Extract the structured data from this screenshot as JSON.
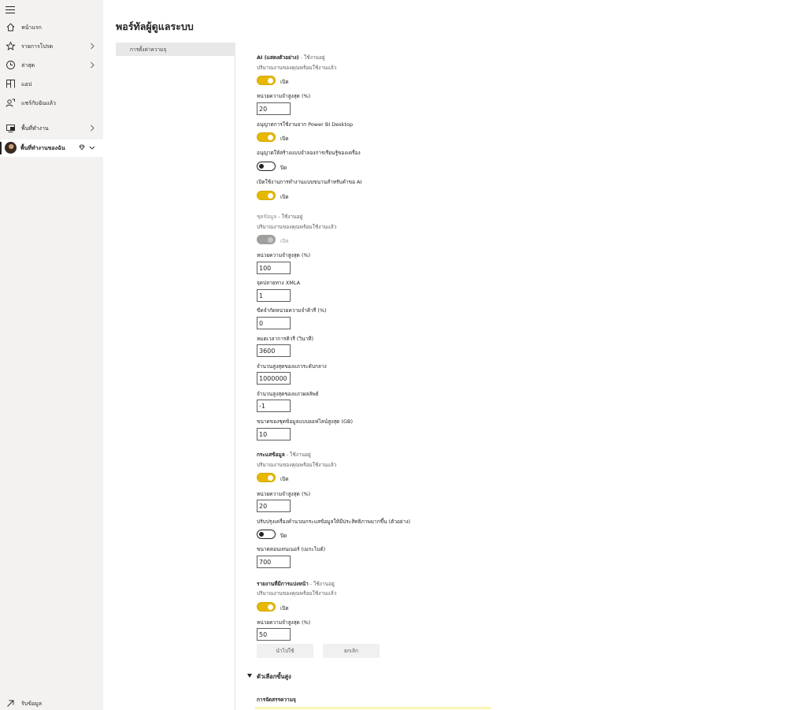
{
  "nav": {
    "items": [
      {
        "label": "หน้าแรก",
        "icon": "home-icon"
      },
      {
        "label": "รายการโปรด",
        "icon": "star-icon"
      },
      {
        "label": "ล่าสุด",
        "icon": "clock-icon"
      },
      {
        "label": "แอป",
        "icon": "apps-icon"
      },
      {
        "label": "แชร์กับฉันแล้ว",
        "icon": "shared-icon"
      },
      {
        "label": "พื้นที่ทำงาน",
        "icon": "workspaces-icon"
      },
      {
        "label": "พื้นที่ทำงานของฉัน",
        "icon": "avatar"
      }
    ],
    "bottom": {
      "label": "รับข้อมูล",
      "icon": "get-data-arrow-icon"
    }
  },
  "header": {
    "title": "พอร์ทัลผู้ดูแลระบบ"
  },
  "tabs": [
    {
      "label": "การตั้งค่าความจุ"
    }
  ],
  "settings": {
    "ai": {
      "title": "AI (แสดงตัวอย่าง)",
      "status": " - ใช้งานอยู่",
      "subtext": "ปริมาณงานของคุณพร้อมใช้งานแล้ว",
      "toggle_label": "เปิด",
      "max_memory_label": "หน่วยความจำสูงสุด (%)",
      "max_memory_value": "20",
      "allow_desktop_label": "อนุญาตการใช้งานจาก Power BI Desktop",
      "allow_desktop_toggle": "เปิด",
      "allow_local_label": "อนุญาตให้สร้างแบบจำลองการเรียนรู้ของเครื่อง",
      "allow_local_toggle": "ปิด",
      "parallel_label": "เปิดใช้งานการทำงานแบบขนานสำหรับคำขอ AI",
      "parallel_toggle": "เปิด"
    },
    "datasets": {
      "title": "ชุดข้อมูล",
      "status": " - ใช้งานอยู่",
      "subtext": "ปริมาณงานของคุณพร้อมใช้งานแล้ว",
      "toggle_label": "เปิด",
      "max_memory_label": "หน่วยความจำสูงสุด (%)",
      "max_memory_value": "100",
      "xmla_label": "จุดปลายทาง XMLA",
      "xmla_value": "1",
      "query_memory_label": "ขีดจำกัดหน่วยความจำคิวรี (%)",
      "query_memory_value": "0",
      "query_timeout_label": "หมดเวลาการคิวรี (วินาที)",
      "query_timeout_value": "3600",
      "max_intermediate_label": "จำนวนสูงสุดของแถวระดับกลาง",
      "max_intermediate_value": "1000000",
      "max_result_label": "จำนวนสูงสุดของแถวผลลัพธ์",
      "max_result_value": "-1",
      "max_offline_label": "ขนาดของชุดข้อมูลแบบออฟไลน์สูงสุด (GB)",
      "max_offline_value": "10"
    },
    "dataflows": {
      "title": "กระแสข้อมูล",
      "status": " - ใช้งานอยู่",
      "subtext": "ปริมาณงานของคุณพร้อมใช้งานแล้ว",
      "toggle_label": "เปิด",
      "max_memory_label": "หน่วยความจำสูงสุด (%)",
      "max_memory_value": "20",
      "enhanced_label": "ปรับปรุงเครื่องคำนวณกระแสข้อมูลให้มีประสิทธิภาพมากขึ้น (ตัวอย่าง)",
      "enhanced_toggle": "ปิด",
      "container_label": "ขนาดคอนเทนเนอร์ (เมกะไบต์)",
      "container_value": "700"
    },
    "paginated": {
      "title": "รายงานที่มีการแบ่งหน้า",
      "status": " - ใช้งานอยู่",
      "subtext": "ปริมาณงานของคุณพร้อมใช้งานแล้ว",
      "toggle_label": "เปิด",
      "max_memory_label": "หน่วยความจำสูงสุด (%)",
      "max_memory_value": "50"
    },
    "buttons": {
      "apply": "นำไปใช้",
      "cancel": "ยกเลิก"
    },
    "advanced": {
      "title": "ตัวเลือกขั้นสูง",
      "memory_title": "การจัดสรรความจุ"
    }
  },
  "colors": {
    "toggle_on": "#e6b800",
    "nav_bg": "#f3f2f1",
    "memory_bar": "#f9f5b4"
  }
}
